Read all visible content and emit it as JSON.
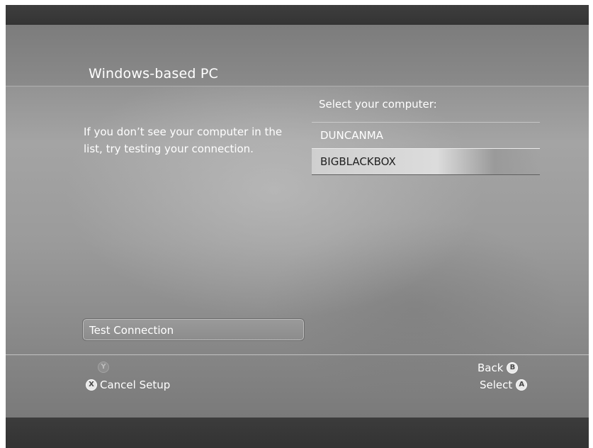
{
  "screen": {
    "title": "Windows-based PC"
  },
  "help": {
    "text": "If you don’t see your computer in the list, try testing your connection."
  },
  "computer_list": {
    "heading": "Select your computer:",
    "items": [
      {
        "label": "DUNCANMA",
        "selected": false
      },
      {
        "label": "BIGBLACKBOX",
        "selected": true
      }
    ]
  },
  "actions": {
    "test_connection": "Test Connection"
  },
  "footer": {
    "y_button_glyph": "Y",
    "x_button_glyph": "X",
    "cancel_label": "Cancel Setup",
    "back_label": "Back",
    "back_glyph": "B",
    "select_label": "Select",
    "select_glyph": "A"
  },
  "colors": {
    "panel": "#9c9c9c",
    "bars": "#3a3a3a",
    "text": "#ffffff",
    "selected_text": "#222222"
  }
}
